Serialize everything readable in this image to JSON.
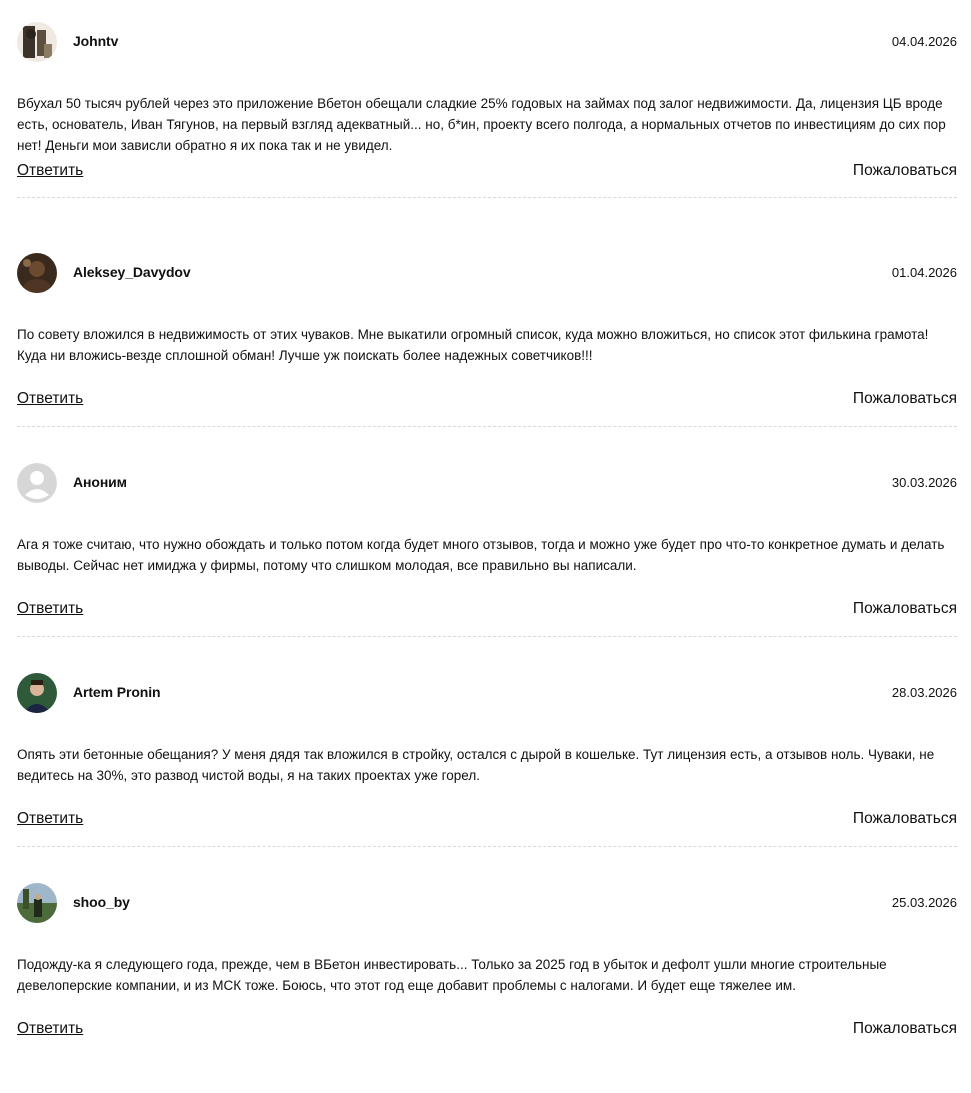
{
  "comments": [
    {
      "author": "Johntv",
      "date": "04.04.2026",
      "avatar": "photo-avatar",
      "text": "Вбухал 50 тысяч рублей через это приложение Вбетон обещали сладкие 25% годовых на займах под залог недвижимости. Да, лицензия ЦБ вроде есть, основатель, Иван Тягунов, на первый взгляд адекватный... но, б*ин, проекту всего полгода, а нормальных отчетов по инвестициям до сих пор нет! Деньги мои зависли обратно я их пока так и не увидел.",
      "reply_label": "Ответить",
      "complain_label": "Пожаловаться"
    },
    {
      "author": "Aleksey_Davydov",
      "date": "01.04.2026",
      "avatar": "photo-avatar",
      "text": "По совету вложился в недвижимость от этих чуваков. Мне выкатили огромный список, куда можно вложиться, но список этот филькина грамота! Куда ни вложись-везде сплошной обман! Лучше уж поискать более надежных советчиков!!!",
      "reply_label": "Ответить",
      "complain_label": "Пожаловаться"
    },
    {
      "author": "Аноним",
      "date": "30.03.2026",
      "avatar": "default-user-icon",
      "text": "Ага я тоже считаю, что нужно обождать и только потом когда будет много отзывов, тогда и можно уже будет про что-то конкретное думать и делать выводы. Сейчас нет имиджа у фирмы, потому что слишком молодая, все правильно вы написали.",
      "reply_label": "Ответить",
      "complain_label": "Пожаловаться"
    },
    {
      "author": "Artem Pronin",
      "date": "28.03.2026",
      "avatar": "photo-avatar",
      "text": "Опять эти бетонные обещания? У меня дядя так вложился в стройку, остался с дырой в кошельке. Тут лицензия есть, а отзывов ноль. Чуваки, не ведитесь на 30%, это развод чистой воды, я на таких проектах уже горел.",
      "reply_label": "Ответить",
      "complain_label": "Пожаловаться"
    },
    {
      "author": "shoo_by",
      "date": "25.03.2026",
      "avatar": "photo-avatar",
      "text": "Подожду-ка я следующего года, прежде, чем в ВБетон инвестировать... Только за 2025 год в убыток и дефолт ушли многие строительные девелоперские компании, и из МСК тоже. Боюсь, что этот год еще добавит проблемы с налогами. И будет еще тяжелее им.",
      "reply_label": "Ответить",
      "complain_label": "Пожаловаться"
    }
  ]
}
